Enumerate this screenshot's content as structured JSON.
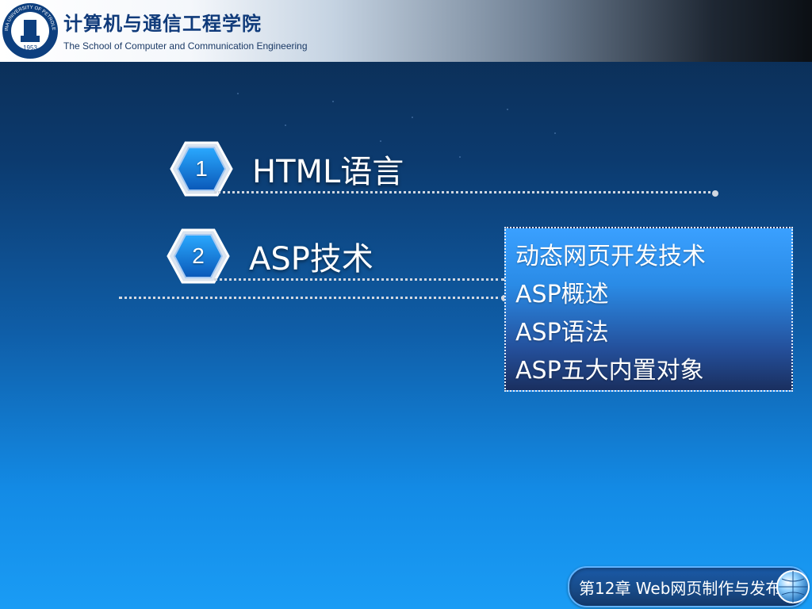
{
  "header": {
    "title": "计算机与通信工程学院",
    "subtitle": "The School of Computer and Communication Engineering",
    "logo_text": "CHINA UNIVERSITY OF PETROLEUM 1953"
  },
  "agenda": [
    {
      "number": "1",
      "title": "HTML语言"
    },
    {
      "number": "2",
      "title": "ASP技术"
    }
  ],
  "info_box": {
    "lines": [
      "动态网页开发技术",
      "ASP概述",
      "ASP语法",
      "ASP五大内置对象"
    ]
  },
  "footer": {
    "text": "第12章 Web网页制作与发布"
  },
  "colors": {
    "header_title": "#0f3a7a",
    "accent_blue": "#138be6",
    "box_border": "#e5edf7"
  }
}
